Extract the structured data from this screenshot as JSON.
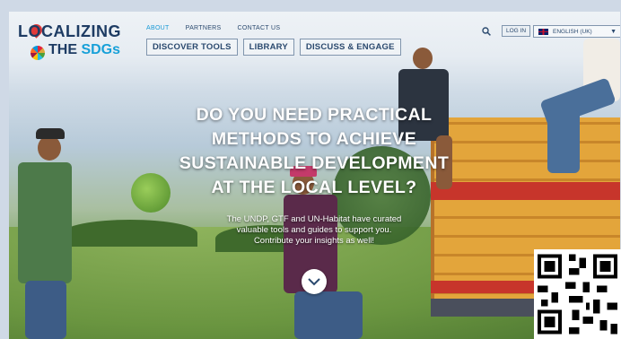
{
  "logo": {
    "line1": "LOCALIZING",
    "line2_prefix": "THE ",
    "line2_accent": "SDGs"
  },
  "topnav": [
    {
      "label": "ABOUT",
      "active": true
    },
    {
      "label": "PARTNERS",
      "active": false
    },
    {
      "label": "CONTACT US",
      "active": false
    }
  ],
  "mainnav": [
    {
      "label": "DISCOVER TOOLS"
    },
    {
      "label": "LIBRARY"
    },
    {
      "label": "DISCUSS & ENGAGE"
    }
  ],
  "header_right": {
    "search_icon": "search-icon",
    "login_label": "LOG IN",
    "language_label": "ENGLISH (UK)",
    "language_caret": "▼"
  },
  "hero": {
    "title_lines": [
      "DO YOU NEED PRACTICAL",
      "METHODS TO ACHIEVE",
      "SUSTAINABLE DEVELOPMENT",
      "AT THE LOCAL LEVEL?"
    ],
    "subtitle_lines": [
      "The UNDP, GTF and UN-Habitat have curated",
      "valuable tools and guides to support you.",
      "Contribute your insights as well!"
    ],
    "scroll_icon": "chevron-down-icon"
  },
  "colors": {
    "brand_dark": "#1d3b63",
    "brand_accent": "#17a0d8",
    "nav_text": "#2b4a6f"
  }
}
